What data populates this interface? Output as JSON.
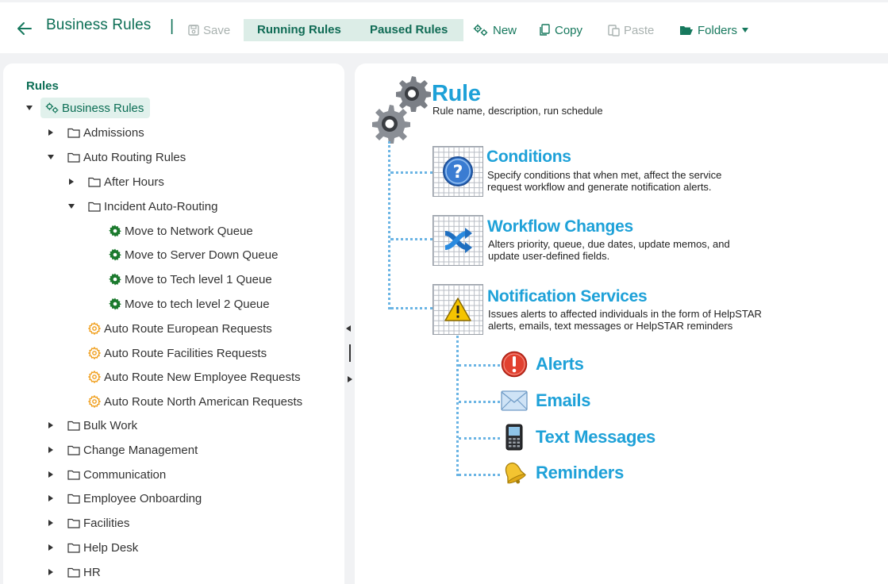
{
  "toolbar": {
    "title": "Business Rules",
    "separator": "|",
    "save_label": "Save",
    "running_label": "Running Rules",
    "paused_label": "Paused Rules",
    "new_label": "New",
    "copy_label": "Copy",
    "paste_label": "Paste",
    "folders_label": "Folders"
  },
  "tree": {
    "heading": "Rules",
    "root": "Business Rules",
    "items": {
      "admissions": "Admissions",
      "auto_routing": "Auto Routing Rules",
      "after_hours": "After Hours",
      "incident": "Incident Auto-Routing",
      "r1": "Move to Network Queue",
      "r2": "Move to Server Down Queue",
      "r3": "Move to Tech level 1 Queue",
      "r4": "Move to tech level 2 Queue",
      "a1": "Auto Route European Requests",
      "a2": "Auto Route Facilities Requests",
      "a3": "Auto Route New Employee Requests",
      "a4": "Auto Route North American Requests",
      "bulk": "Bulk Work",
      "change": "Change Management",
      "communication": "Communication",
      "onboarding": "Employee Onboarding",
      "facilities": "Facilities",
      "helpdesk": "Help Desk",
      "hr": "HR"
    }
  },
  "diagram": {
    "rule_title": "Rule",
    "rule_desc": "Rule name, description, run schedule",
    "conditions_title": "Conditions",
    "conditions_desc1": "Specify conditions that when met, affect the service",
    "conditions_desc2": "request  workflow and generate notification alerts.",
    "workflow_title": "Workflow Changes",
    "workflow_desc1": "Alters priority, queue, due dates, update memos, and",
    "workflow_desc2": "update user-defined fields.",
    "notif_title": "Notification Services",
    "notif_desc1": "Issues alerts to affected individuals in the form of HelpSTAR",
    "notif_desc2": "alerts, emails, text messages or HelpSTAR reminders",
    "alerts": "Alerts",
    "emails": "Emails",
    "texts": "Text Messages",
    "reminders": "Reminders"
  },
  "colors": {
    "brand_green": "#0c6e55",
    "diagram_blue": "#1ea1d8",
    "segment_bg": "#dcede7",
    "rule_gear_green": "#1c7a2e",
    "rule_gear_orange": "#f0a020"
  }
}
